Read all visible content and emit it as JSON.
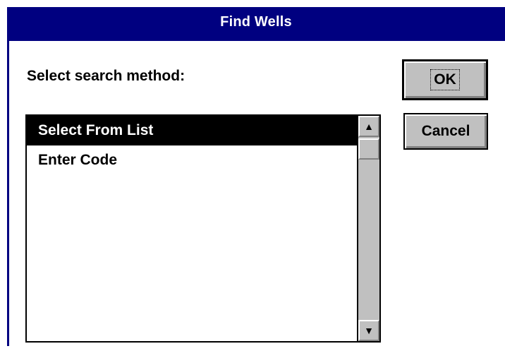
{
  "window": {
    "title": "Find Wells"
  },
  "prompt": "Select search method:",
  "list": {
    "items": [
      {
        "label": "Select From List",
        "selected": true
      },
      {
        "label": "Enter Code",
        "selected": false
      }
    ]
  },
  "buttons": {
    "ok": "OK",
    "cancel": "Cancel"
  },
  "scrollbar": {
    "up_icon": "arrow-up-icon",
    "down_icon": "arrow-down-icon"
  },
  "colors": {
    "titlebar": "#000080",
    "selection": "#000000",
    "button_face": "#c0c0c0"
  }
}
